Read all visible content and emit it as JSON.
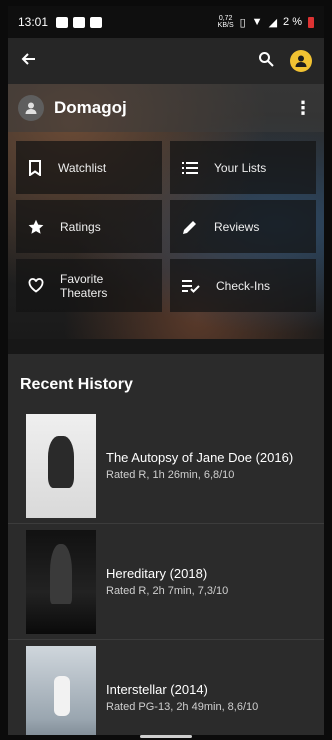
{
  "status": {
    "time": "13:01",
    "net_speed_value": "0,72",
    "net_speed_unit": "KB/S",
    "battery": "2 %"
  },
  "profile": {
    "name": "Domagoj"
  },
  "tiles": [
    {
      "label": "Watchlist",
      "icon": "bookmark-icon"
    },
    {
      "label": "Your Lists",
      "icon": "list-icon"
    },
    {
      "label": "Ratings",
      "icon": "star-icon"
    },
    {
      "label": "Reviews",
      "icon": "pencil-icon"
    },
    {
      "label": "Favorite Theaters",
      "icon": "heart-icon"
    },
    {
      "label": "Check-Ins",
      "icon": "checklist-icon"
    }
  ],
  "recent_history": {
    "title": "Recent History",
    "items": [
      {
        "title": "The Autopsy of Jane Doe (2016)",
        "meta": "Rated R, 1h 26min, 6,8/10"
      },
      {
        "title": "Hereditary (2018)",
        "meta": "Rated R, 2h 7min, 7,3/10"
      },
      {
        "title": "Interstellar (2014)",
        "meta": "Rated PG-13, 2h 49min, 8,6/10"
      }
    ]
  },
  "colors": {
    "accent": "#f1c232",
    "background": "#2b2b2b",
    "battery_low": "#dd3333"
  }
}
